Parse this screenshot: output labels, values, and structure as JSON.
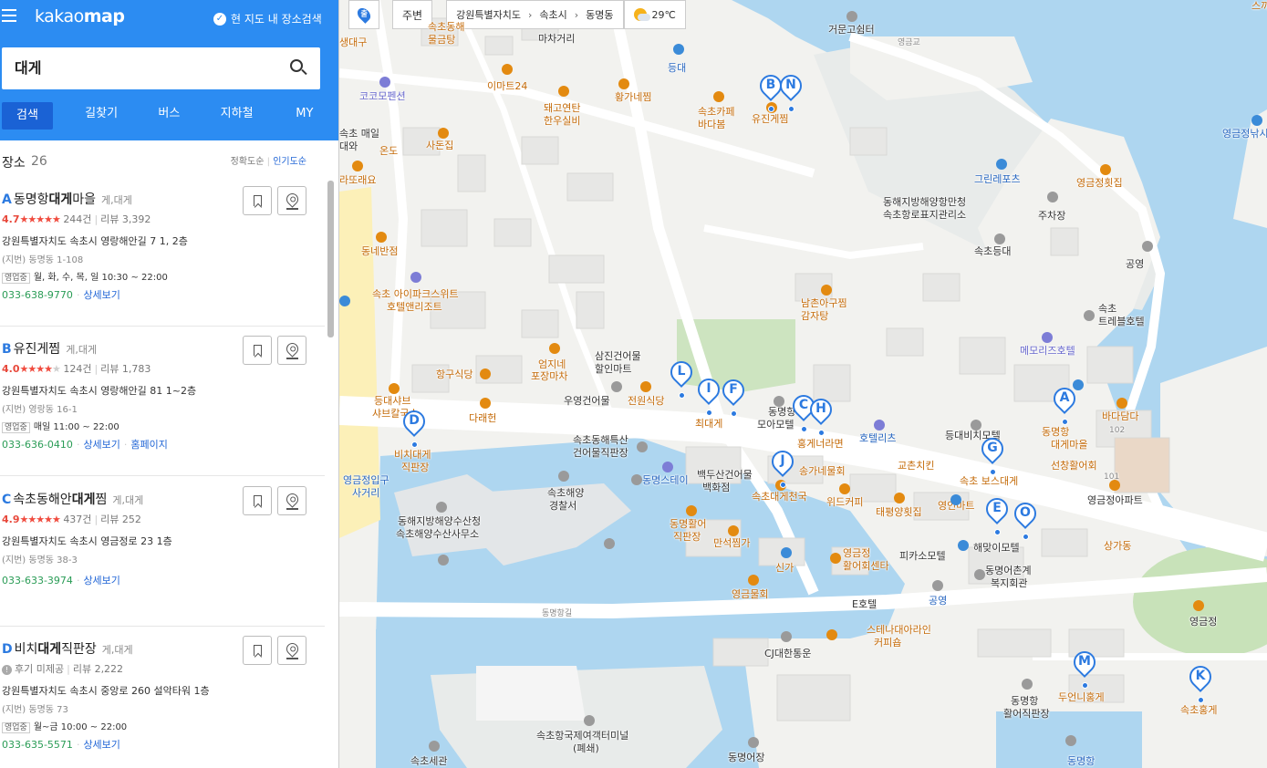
{
  "header": {
    "logo_light": "kakao",
    "logo_bold": "map",
    "area_search_label": "현 지도 내 장소검색"
  },
  "search": {
    "query": "대게",
    "placeholder": ""
  },
  "tabs": [
    {
      "label": "검색",
      "active": true
    },
    {
      "label": "길찾기"
    },
    {
      "label": "버스"
    },
    {
      "label": "지하철"
    },
    {
      "label": "MY"
    }
  ],
  "results": {
    "title": "장소",
    "count": "26",
    "sort_accuracy": "정확도순",
    "sort_popular": "인기도순",
    "items": [
      {
        "marker": "A",
        "name_pre": "동명항",
        "name_hl": "대게",
        "name_post": "마을",
        "category": "게,대게",
        "score": "4.7",
        "stars_on": "★★★★★",
        "stars_off": "",
        "reviews_count": "244건",
        "reviews_label": "리뷰 3,392",
        "address": "강원특별자치도 속초시 영랑해안길 7 1, 2층",
        "jibun": "(지번) 동명동 1-108",
        "hours_badge": "영업중",
        "hours": "월, 화, 수, 목, 일 10:30 ~ 22:00",
        "phone": "033-638-9770",
        "detail": "상세보기",
        "homepage": ""
      },
      {
        "marker": "B",
        "name_pre": "유진게찜",
        "name_hl": "",
        "name_post": "",
        "category": "게,대게",
        "score": "4.0",
        "stars_on": "★★★★",
        "stars_off": "★",
        "reviews_count": "124건",
        "reviews_label": "리뷰 1,783",
        "address": "강원특별자치도 속초시 영랑해안길 81 1~2층",
        "jibun": "(지번) 영랑동 16-1",
        "hours_badge": "영업중",
        "hours": "매일 11:00 ~ 22:00",
        "phone": "033-636-0410",
        "detail": "상세보기",
        "homepage": "홈페이지"
      },
      {
        "marker": "C",
        "name_pre": "속초동해안",
        "name_hl": "대게",
        "name_post": "찜",
        "category": "게,대게",
        "score": "4.9",
        "stars_on": "★★★★★",
        "stars_off": "",
        "reviews_count": "437건",
        "reviews_label": "리뷰 252",
        "address": "강원특별자치도 속초시 영금정로 23 1층",
        "jibun": "(지번) 동명동 38-3",
        "hours_badge": "",
        "hours": "",
        "phone": "033-633-3974",
        "detail": "상세보기",
        "homepage": ""
      },
      {
        "marker": "D",
        "name_pre": "비치",
        "name_hl": "대게",
        "name_post": "직판장",
        "category": "게,대게",
        "score": "",
        "stars_on": "",
        "stars_off": "",
        "reviews_count": "후기 미제공",
        "reviews_label": "리뷰 2,222",
        "address": "강원특별자치도 속초시 중앙로 260 설악타워 1층",
        "jibun": "(지번) 동명동 73",
        "hours_badge": "영업중",
        "hours": "월~금 10:00 ~ 22:00",
        "phone": "033-635-5571",
        "detail": "상세보기",
        "homepage": ""
      }
    ]
  },
  "map_toolbar": {
    "marker_glyph": "출",
    "near": "주변",
    "crumbs": [
      "강원특별자치도",
      "속초시",
      "동명동"
    ],
    "weather": "29℃"
  },
  "map_labels": [
    "생대구",
    "마차거리",
    "속초동해",
    "물금탕",
    "이마트24",
    "돼고연탄",
    "한우실비",
    "황가네찜",
    "속초카페",
    "바다봄",
    "유진게찜",
    "거문고쉼터",
    "영금교",
    "등대",
    "영금정낚시",
    "코코모펜션",
    "속초 매일",
    "대와",
    "온도",
    "사돈집",
    "라또래요",
    "그린레포츠",
    "영금정횟집",
    "동해지방해양항만청",
    "속초항로표지관리소",
    "주차장",
    "속초등대",
    "공영",
    "동네반점",
    "속초 아이파크스위트",
    "호텔앤리조트",
    "남촌아구찜",
    "감자탕",
    "속초",
    "트레블호텔",
    "메모리즈호텔",
    "스끼다시천국",
    "바다담다",
    "102",
    "항구식당",
    "엄지네",
    "포장마차",
    "삼진건어물",
    "할인마트",
    "우영건어물",
    "전원식당",
    "등대샤브",
    "샤브칼국수",
    "다래헌",
    "비치대게",
    "직판장",
    "최대게",
    "동명항",
    "모아모텔",
    "홍게너라면",
    "호텔리츠",
    "등대비치모텔",
    "동명항",
    "대게마을",
    "속초해양",
    "경찰서",
    "속초동해특산",
    "건어물직판장",
    "동명스테이",
    "백두산건어물",
    "백화점",
    "속초대게천국",
    "송가네물회",
    "위드커피",
    "교촌치킨",
    "속초 보스대게",
    "선창활어회",
    "101",
    "영금정아파트",
    "영금정입구",
    "사거리",
    "동해지방해양수산청",
    "속초해양수산사무소",
    "동명활어",
    "직판장",
    "만석찜가",
    "신가",
    "영금정",
    "활어회센타",
    "피카소모텔",
    "영인마트",
    "태평양횟집",
    "해맞이모텔",
    "상가동",
    "동명어촌계",
    "복지회관",
    "영금물회",
    "E호텔",
    "공영",
    "영금정",
    "동명항길",
    "스테나대아라인",
    "커피숍",
    "CJ대한통운",
    "두언니홍게",
    "속초홍게",
    "동명항",
    "활어직판장",
    "속초항국제여객터미널",
    "(폐쇄)",
    "속초세관",
    "동명어장",
    "동명항"
  ]
}
